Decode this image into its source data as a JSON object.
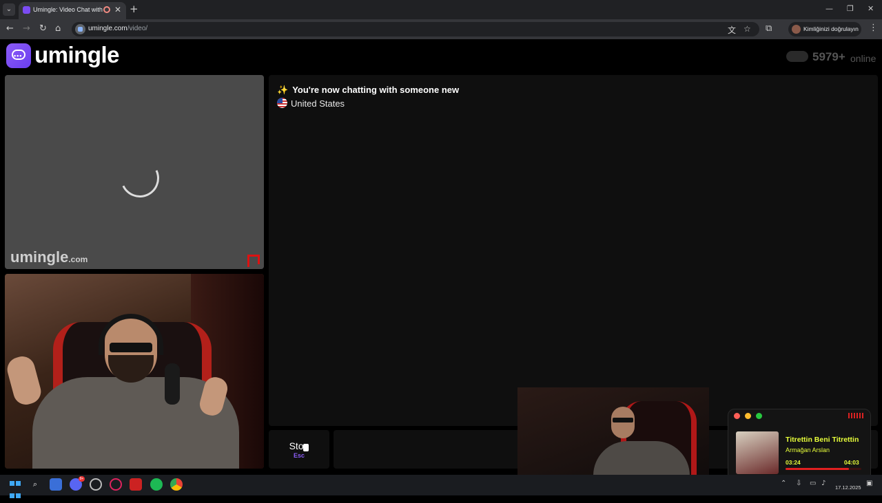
{
  "browser": {
    "tab_title": "Umingle: Video Chat with S",
    "tab_close": "✕",
    "new_tab": "+",
    "url_host": "umingle.com",
    "url_path": "/video/",
    "profile_label": "Kimliğinizi doğrulayın",
    "window_controls": [
      "—",
      "❐",
      "✕"
    ]
  },
  "site": {
    "logo_text": "umingle",
    "logo_dots": "•••",
    "online_count": "5979+",
    "online_label": "online",
    "watermark_main": "umingle",
    "watermark_suffix": ".com"
  },
  "chat": {
    "sparkle": "✨",
    "status_line": "You're now chatting with someone new",
    "country": "United States"
  },
  "controls": {
    "stop_label": "Stop",
    "stop_key": "Esc"
  },
  "music": {
    "title": "Titrettin Beni Titrettin",
    "artist": "Armağan Arslan",
    "time_current": "03:24",
    "time_total": "04:03",
    "progress": 0.84,
    "colors": {
      "text": "#e8ff3a",
      "progress": "#e02020"
    }
  },
  "taskbar": {
    "discord_badge": "9+",
    "date": "17.12.2025"
  },
  "colors": {
    "brand": "#7b4cf2",
    "stop_key": "#8b5cf6",
    "report": "#dd1111"
  }
}
